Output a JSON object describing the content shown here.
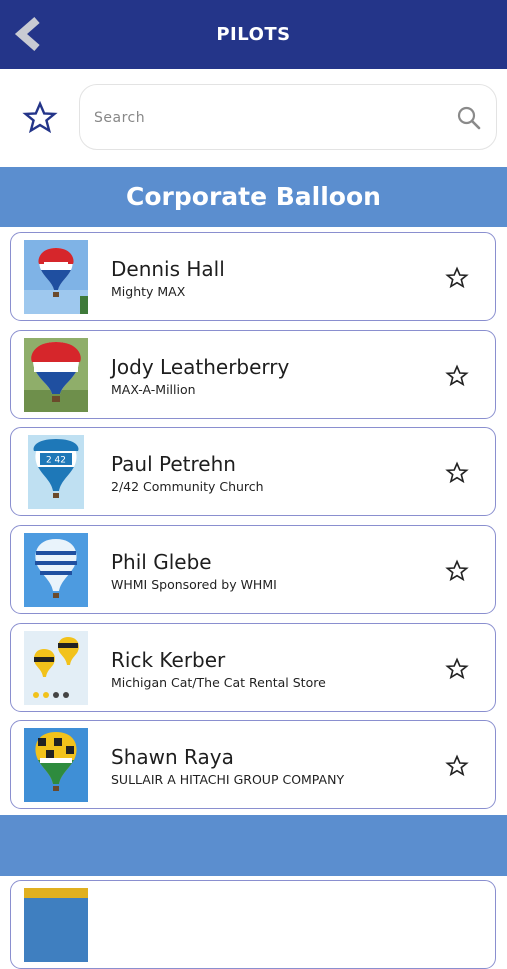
{
  "header": {
    "title": "PILOTS",
    "back_icon": "chevron-left-icon"
  },
  "search": {
    "placeholder": "Search",
    "value": "",
    "icon": "search-icon",
    "favorites_icon": "star-outline-icon"
  },
  "colors": {
    "header": "#243589",
    "section": "#5b8ecf",
    "card_border": "#8a8fcf",
    "star": "#243589"
  },
  "sections": [
    {
      "title": "Corporate Balloon",
      "pilots": [
        {
          "name": "Dennis Hall",
          "balloon": "Mighty MAX"
        },
        {
          "name": "Jody Leatherberry",
          "balloon": "MAX-A-Million"
        },
        {
          "name": "Paul Petrehn",
          "balloon": "2/42 Community Church"
        },
        {
          "name": "Phil Glebe",
          "balloon": "WHMI Sponsored by WHMI"
        },
        {
          "name": "Rick Kerber",
          "balloon": "Michigan Cat/The Cat Rental Store"
        },
        {
          "name": "Shawn Raya",
          "balloon": "SULLAIR A HITACHI GROUP COMPANY"
        }
      ]
    },
    {
      "title": ""
    }
  ]
}
